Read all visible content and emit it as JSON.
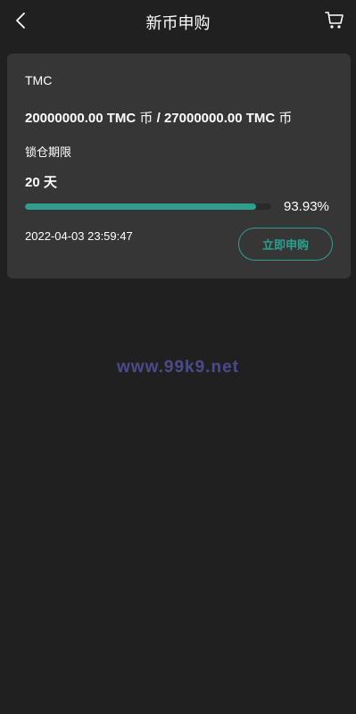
{
  "header": {
    "title": "新币申购",
    "back_icon": "chevron-left-icon",
    "cart_icon": "cart-icon"
  },
  "card": {
    "coin_name": "TMC",
    "subscribed_amount": "20000000.00 TMC",
    "subscribed_unit": "币",
    "separator": "/",
    "total_amount": "27000000.00 TMC",
    "total_unit": "币",
    "lock_label": "锁仓期限",
    "lock_value": "20 天",
    "progress": 0.9393,
    "progress_text": "93.93%",
    "end_time": "2022-04-03 23:59:47",
    "subscribe_label": "立即申购"
  },
  "watermark": "www.99k9.net",
  "colors": {
    "background": "#202020",
    "card": "#363636",
    "accent": "#2f9e8c",
    "watermark": "#4c4a8c"
  }
}
